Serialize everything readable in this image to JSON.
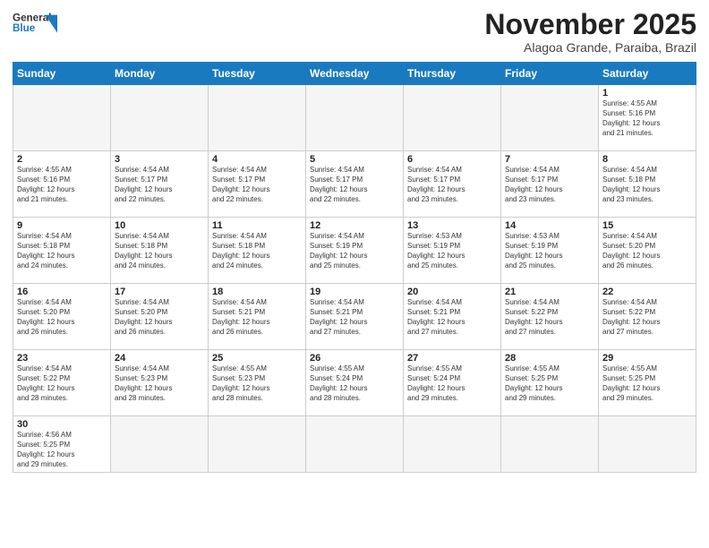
{
  "header": {
    "logo_line1": "General",
    "logo_line2": "Blue",
    "month": "November 2025",
    "location": "Alagoa Grande, Paraiba, Brazil"
  },
  "days_of_week": [
    "Sunday",
    "Monday",
    "Tuesday",
    "Wednesday",
    "Thursday",
    "Friday",
    "Saturday"
  ],
  "weeks": [
    [
      {
        "day": "",
        "info": ""
      },
      {
        "day": "",
        "info": ""
      },
      {
        "day": "",
        "info": ""
      },
      {
        "day": "",
        "info": ""
      },
      {
        "day": "",
        "info": ""
      },
      {
        "day": "",
        "info": ""
      },
      {
        "day": "1",
        "info": "Sunrise: 4:55 AM\nSunset: 5:16 PM\nDaylight: 12 hours\nand 21 minutes."
      }
    ],
    [
      {
        "day": "2",
        "info": "Sunrise: 4:55 AM\nSunset: 5:16 PM\nDaylight: 12 hours\nand 21 minutes."
      },
      {
        "day": "3",
        "info": "Sunrise: 4:54 AM\nSunset: 5:17 PM\nDaylight: 12 hours\nand 22 minutes."
      },
      {
        "day": "4",
        "info": "Sunrise: 4:54 AM\nSunset: 5:17 PM\nDaylight: 12 hours\nand 22 minutes."
      },
      {
        "day": "5",
        "info": "Sunrise: 4:54 AM\nSunset: 5:17 PM\nDaylight: 12 hours\nand 22 minutes."
      },
      {
        "day": "6",
        "info": "Sunrise: 4:54 AM\nSunset: 5:17 PM\nDaylight: 12 hours\nand 23 minutes."
      },
      {
        "day": "7",
        "info": "Sunrise: 4:54 AM\nSunset: 5:17 PM\nDaylight: 12 hours\nand 23 minutes."
      },
      {
        "day": "8",
        "info": "Sunrise: 4:54 AM\nSunset: 5:18 PM\nDaylight: 12 hours\nand 23 minutes."
      }
    ],
    [
      {
        "day": "9",
        "info": "Sunrise: 4:54 AM\nSunset: 5:18 PM\nDaylight: 12 hours\nand 24 minutes."
      },
      {
        "day": "10",
        "info": "Sunrise: 4:54 AM\nSunset: 5:18 PM\nDaylight: 12 hours\nand 24 minutes."
      },
      {
        "day": "11",
        "info": "Sunrise: 4:54 AM\nSunset: 5:18 PM\nDaylight: 12 hours\nand 24 minutes."
      },
      {
        "day": "12",
        "info": "Sunrise: 4:54 AM\nSunset: 5:19 PM\nDaylight: 12 hours\nand 25 minutes."
      },
      {
        "day": "13",
        "info": "Sunrise: 4:53 AM\nSunset: 5:19 PM\nDaylight: 12 hours\nand 25 minutes."
      },
      {
        "day": "14",
        "info": "Sunrise: 4:53 AM\nSunset: 5:19 PM\nDaylight: 12 hours\nand 25 minutes."
      },
      {
        "day": "15",
        "info": "Sunrise: 4:54 AM\nSunset: 5:20 PM\nDaylight: 12 hours\nand 26 minutes."
      }
    ],
    [
      {
        "day": "16",
        "info": "Sunrise: 4:54 AM\nSunset: 5:20 PM\nDaylight: 12 hours\nand 26 minutes."
      },
      {
        "day": "17",
        "info": "Sunrise: 4:54 AM\nSunset: 5:20 PM\nDaylight: 12 hours\nand 26 minutes."
      },
      {
        "day": "18",
        "info": "Sunrise: 4:54 AM\nSunset: 5:21 PM\nDaylight: 12 hours\nand 26 minutes."
      },
      {
        "day": "19",
        "info": "Sunrise: 4:54 AM\nSunset: 5:21 PM\nDaylight: 12 hours\nand 27 minutes."
      },
      {
        "day": "20",
        "info": "Sunrise: 4:54 AM\nSunset: 5:21 PM\nDaylight: 12 hours\nand 27 minutes."
      },
      {
        "day": "21",
        "info": "Sunrise: 4:54 AM\nSunset: 5:22 PM\nDaylight: 12 hours\nand 27 minutes."
      },
      {
        "day": "22",
        "info": "Sunrise: 4:54 AM\nSunset: 5:22 PM\nDaylight: 12 hours\nand 27 minutes."
      }
    ],
    [
      {
        "day": "23",
        "info": "Sunrise: 4:54 AM\nSunset: 5:22 PM\nDaylight: 12 hours\nand 28 minutes."
      },
      {
        "day": "24",
        "info": "Sunrise: 4:54 AM\nSunset: 5:23 PM\nDaylight: 12 hours\nand 28 minutes."
      },
      {
        "day": "25",
        "info": "Sunrise: 4:55 AM\nSunset: 5:23 PM\nDaylight: 12 hours\nand 28 minutes."
      },
      {
        "day": "26",
        "info": "Sunrise: 4:55 AM\nSunset: 5:24 PM\nDaylight: 12 hours\nand 28 minutes."
      },
      {
        "day": "27",
        "info": "Sunrise: 4:55 AM\nSunset: 5:24 PM\nDaylight: 12 hours\nand 29 minutes."
      },
      {
        "day": "28",
        "info": "Sunrise: 4:55 AM\nSunset: 5:25 PM\nDaylight: 12 hours\nand 29 minutes."
      },
      {
        "day": "29",
        "info": "Sunrise: 4:55 AM\nSunset: 5:25 PM\nDaylight: 12 hours\nand 29 minutes."
      }
    ],
    [
      {
        "day": "30",
        "info": "Sunrise: 4:56 AM\nSunset: 5:25 PM\nDaylight: 12 hours\nand 29 minutes."
      },
      {
        "day": "",
        "info": ""
      },
      {
        "day": "",
        "info": ""
      },
      {
        "day": "",
        "info": ""
      },
      {
        "day": "",
        "info": ""
      },
      {
        "day": "",
        "info": ""
      },
      {
        "day": "",
        "info": ""
      }
    ]
  ]
}
